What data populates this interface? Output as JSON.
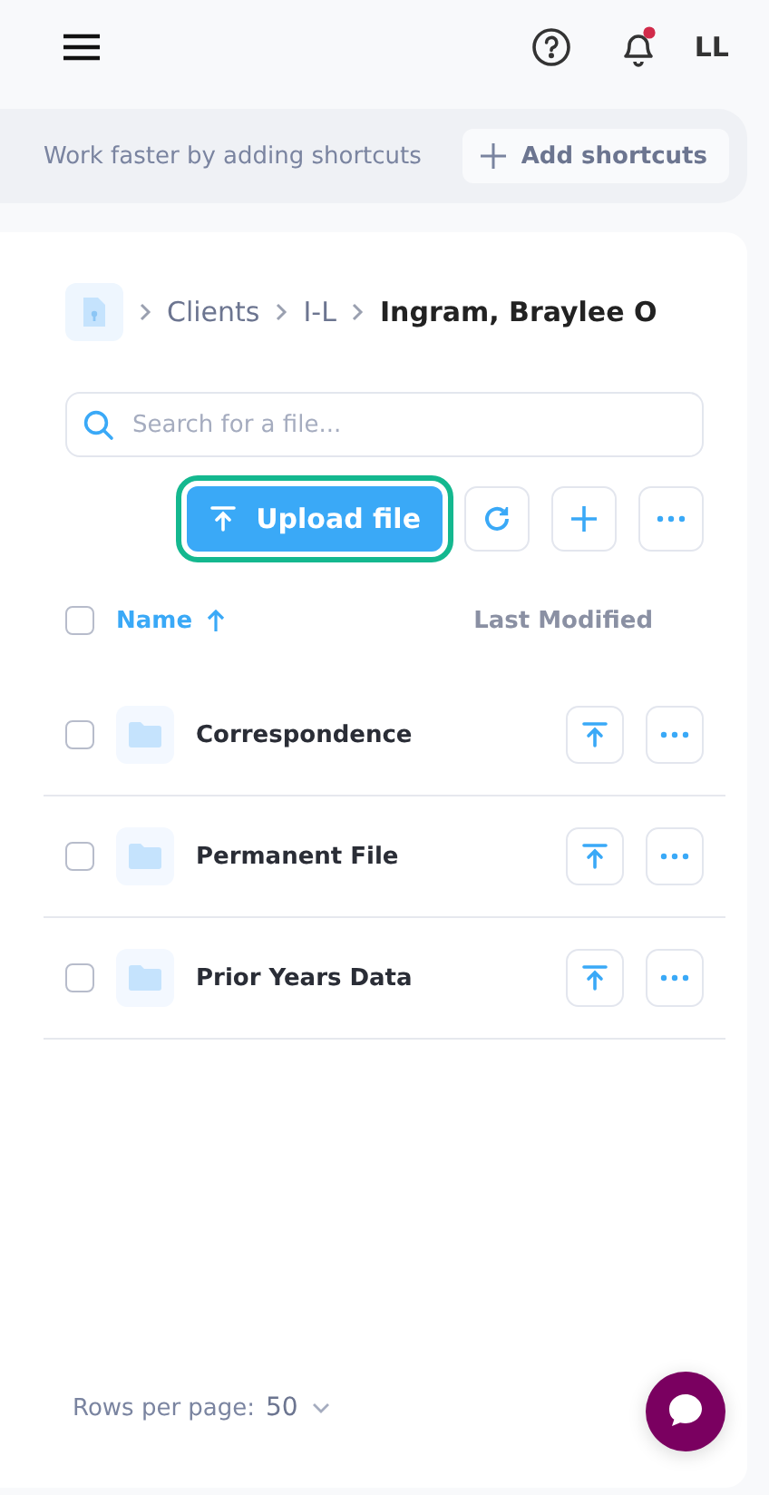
{
  "header": {
    "avatar": "LL",
    "notification_unread": true
  },
  "shortcuts": {
    "message": "Work faster by adding shortcuts",
    "button": "Add shortcuts"
  },
  "breadcrumb": [
    "Clients",
    "I-L",
    "Ingram, Braylee O"
  ],
  "search": {
    "placeholder": "Search for a file..."
  },
  "toolbar": {
    "upload": {
      "label": "Upload file",
      "focused": true
    }
  },
  "table": {
    "all_checked": false,
    "columns": [
      {
        "label": "Name",
        "sorted": true
      },
      {
        "label": "Last Modified",
        "sorted": false
      }
    ],
    "rows": [
      {
        "name": "Correspondence",
        "checked": false
      },
      {
        "name": "Permanent File",
        "checked": false
      },
      {
        "name": "Prior Years Data",
        "checked": false
      }
    ]
  },
  "pagination": {
    "label": "Rows per page:",
    "value": "50"
  }
}
